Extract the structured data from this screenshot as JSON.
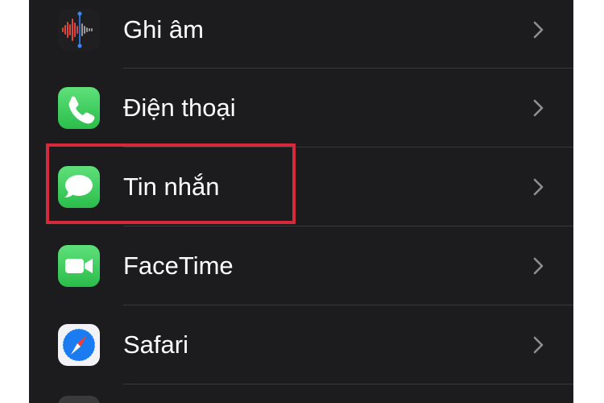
{
  "settings": {
    "items": [
      {
        "label": "Ghi âm",
        "icon": "voice-memos-icon"
      },
      {
        "label": "Điện thoại",
        "icon": "phone-icon"
      },
      {
        "label": "Tin nhắn",
        "icon": "messages-icon"
      },
      {
        "label": "FaceTime",
        "icon": "facetime-icon"
      },
      {
        "label": "Safari",
        "icon": "safari-icon"
      }
    ],
    "highlighted_item": "Tin nhắn"
  },
  "colors": {
    "panel_background": "#1c1c1e",
    "text": "#ffffff",
    "chevron": "#8e8e93",
    "divider": "#38383a",
    "highlight_border": "#d42a3a",
    "icon_green": "#34c759",
    "safari_blue": "#1a7cf0"
  }
}
